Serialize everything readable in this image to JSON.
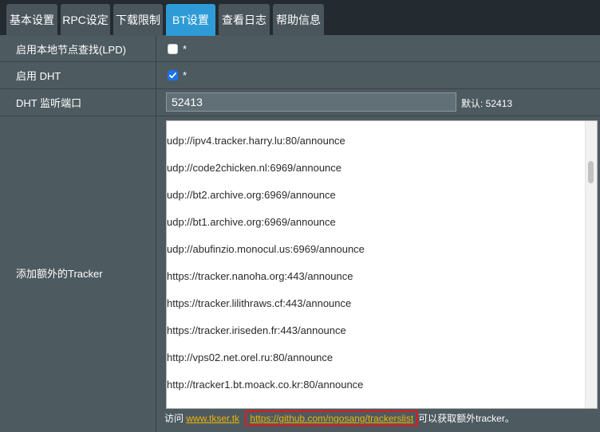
{
  "tabs": [
    {
      "label": "基本设置",
      "active": false
    },
    {
      "label": "RPC设定",
      "active": false
    },
    {
      "label": "下载限制",
      "active": false
    },
    {
      "label": "BT设置",
      "active": true
    },
    {
      "label": "查看日志",
      "active": false
    },
    {
      "label": "帮助信息",
      "active": false
    }
  ],
  "settings": {
    "lpd": {
      "label": "启用本地节点查找(LPD)",
      "checked": false,
      "mark": "*"
    },
    "dht": {
      "label": "启用 DHT",
      "checked": true,
      "mark": "*"
    },
    "dht_port": {
      "label": "DHT 监听端口",
      "value": "52413",
      "default_text": "默认: 52413"
    },
    "tracker": {
      "label": "添加额外的Tracker",
      "lines": [
        "udp://ipv4.tracker.harry.lu:80/announce",
        "udp://code2chicken.nl:6969/announce",
        "udp://bt2.archive.org:6969/announce",
        "udp://bt1.archive.org:6969/announce",
        "udp://abufinzio.monocul.us:6969/announce",
        "https://tracker.nanoha.org:443/announce",
        "https://tracker.lilithraws.cf:443/announce",
        "https://tracker.iriseden.fr:443/announce",
        "http://vps02.net.orel.ru:80/announce",
        "http://tracker1.bt.moack.co.kr:80/announce"
      ]
    }
  },
  "footer": {
    "prefix": "访问",
    "link1": "www.tkser.tk",
    "link2": "https://github.com/ngosang/trackerslist",
    "suffix": "可以获取额外tracker。"
  },
  "colors": {
    "active_tab": "#2e9bd6",
    "link": "#f0b400",
    "highlight": "#e0191b"
  }
}
